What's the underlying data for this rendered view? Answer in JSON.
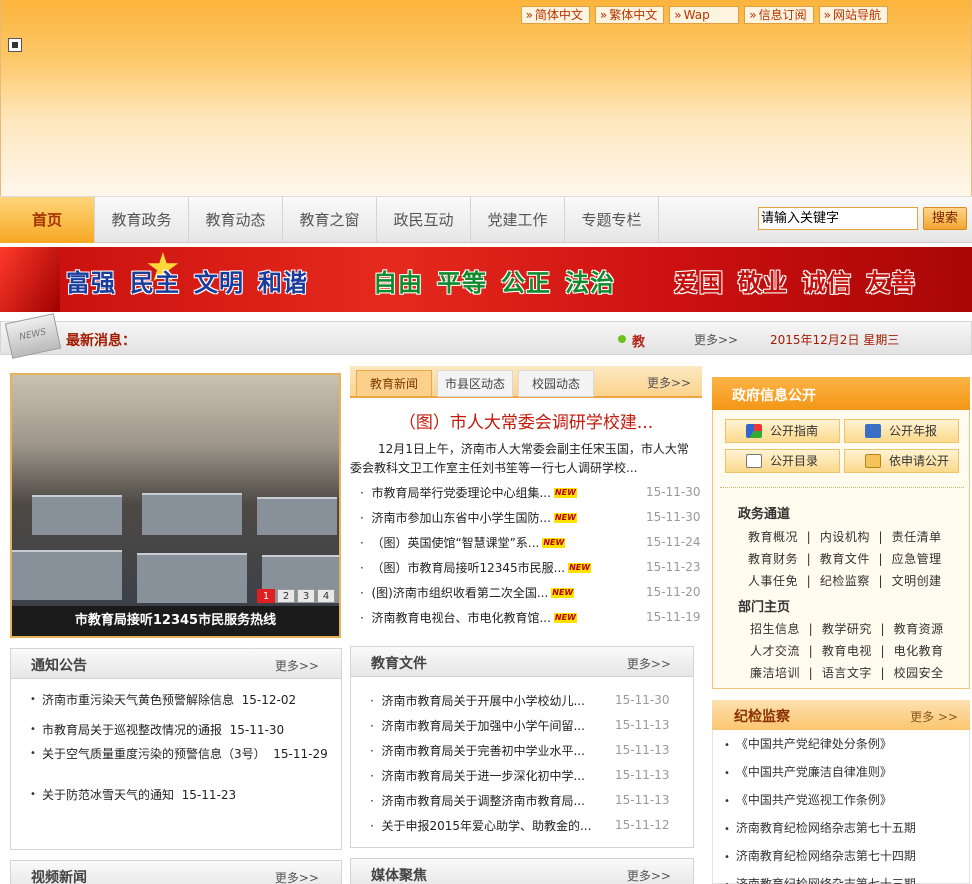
{
  "top_links": [
    "简体中文",
    "繁体中文",
    "Wap",
    "信息订阅",
    "网站导航"
  ],
  "nav": {
    "items": [
      "首页",
      "教育政务",
      "教育动态",
      "教育之窗",
      "政民互动",
      "党建工作",
      "专题专栏"
    ],
    "active": "首页"
  },
  "search": {
    "placeholder": "请输入关键字",
    "button": "搜索"
  },
  "banner": {
    "words": [
      "富强",
      "民主",
      "文明",
      "和谐",
      "自由",
      "平等",
      "公正",
      "法治",
      "爱国",
      "敬业",
      "诚信",
      "友善"
    ]
  },
  "news_bar": {
    "label": "最新消息：",
    "scroll_text": "教",
    "more": "更多>>",
    "date": "2015年12月2日  星期三"
  },
  "photo": {
    "caption": "市教育局接听12345市民服务热线",
    "pages": [
      "1",
      "2",
      "3",
      "4"
    ],
    "active_page": "1"
  },
  "center": {
    "tabs": [
      "教育新闻",
      "市县区动态",
      "校园动态"
    ],
    "active_tab": "教育新闻",
    "more": "更多>>",
    "headline": "（图）市人大常委会调研学校建...",
    "summary": "12月1日上午，济南市人大常委会副主任宋玉国，市人大常委会教科文卫工作室主任刘书笙等一行七人调研学校...",
    "new_tag": "NEW",
    "items": [
      {
        "title": "市教育局举行党委理论中心组集...",
        "date": "15-11-30",
        "new": true
      },
      {
        "title": "济南市参加山东省中小学生国防...",
        "date": "15-11-30",
        "new": true
      },
      {
        "title": "（图）英国使馆“智慧课堂”系...",
        "date": "15-11-24",
        "new": true
      },
      {
        "title": "（图）市教育局接听12345市民服...",
        "date": "15-11-23",
        "new": true
      },
      {
        "title": "(图)济南市组织收看第二次全国...",
        "date": "15-11-20",
        "new": true
      },
      {
        "title": "济南教育电视台、市电化教育馆...",
        "date": "15-11-19",
        "new": true
      }
    ]
  },
  "notices": {
    "title": "通知公告",
    "more": "更多>>",
    "items": [
      {
        "title": "济南市重污染天气黄色预警解除信息",
        "date": "15-12-02"
      },
      {
        "title": "市教育局关于巡视整改情况的通报",
        "date": "15-11-30"
      },
      {
        "title": "关于空气质量重度污染的预警信息（3号）",
        "date": "15-11-29"
      },
      {
        "title": "关于防范冰雪天气的通知",
        "date": "15-11-23"
      }
    ]
  },
  "documents": {
    "title": "教育文件",
    "more": "更多>>",
    "items": [
      {
        "title": "济南市教育局关于开展中小学校幼儿...",
        "date": "15-11-30"
      },
      {
        "title": "济南市教育局关于加强中小学午间留...",
        "date": "15-11-13"
      },
      {
        "title": "济南市教育局关于完善初中学业水平...",
        "date": "15-11-13"
      },
      {
        "title": "济南市教育局关于进一步深化初中学...",
        "date": "15-11-13"
      },
      {
        "title": "济南市教育局关于调整济南市教育局...",
        "date": "15-11-13"
      },
      {
        "title": "关于申报2015年爱心助学、助教金的...",
        "date": "15-11-12"
      }
    ]
  },
  "video": {
    "title": "视频新闻",
    "more": "更多>>"
  },
  "media": {
    "title": "媒体聚焦",
    "more": "更多>>"
  },
  "gov_info": {
    "title": "政府信息公开",
    "buttons": [
      "公开指南",
      "公开年报",
      "公开目录",
      "依申请公开"
    ],
    "section1": "政务通道",
    "links1": [
      [
        "教育概况",
        "内设机构",
        "责任清单"
      ],
      [
        "教育财务",
        "教育文件",
        "应急管理"
      ],
      [
        "人事任免",
        "纪检监察",
        "文明创建"
      ]
    ],
    "section2": "部门主页",
    "links2": [
      [
        "招生信息",
        "教学研究",
        "教育资源"
      ],
      [
        "人才交流",
        "教育电视",
        "电化教育"
      ],
      [
        "廉洁培训",
        "语言文字",
        "校园安全"
      ]
    ]
  },
  "discipline": {
    "title": "纪检监察",
    "more": "更多 >>",
    "items": [
      "《中国共产党纪律处分条例》",
      "《中国共产党廉洁自律准则》",
      "《中国共产党巡视工作条例》",
      "济南教育纪检网络杂志第七十五期",
      "济南教育纪检网络杂志第七十四期",
      "济南教育纪检网络杂志第七十三期"
    ]
  },
  "colors": {
    "accent": "#f39615",
    "brand_red": "#c5190b",
    "nav_active": "#f7a823"
  }
}
